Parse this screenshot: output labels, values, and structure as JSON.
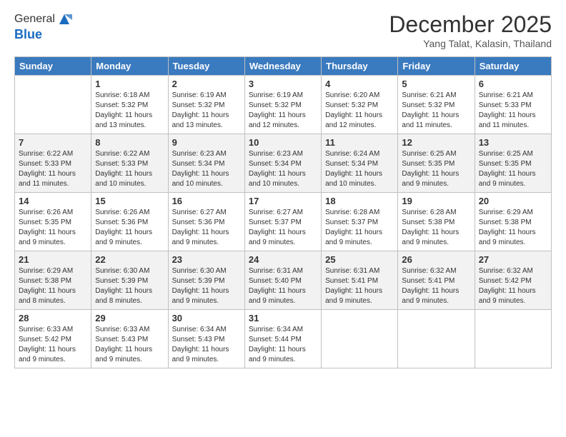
{
  "header": {
    "logo_line1": "General",
    "logo_line2": "Blue",
    "month": "December 2025",
    "location": "Yang Talat, Kalasin, Thailand"
  },
  "days_of_week": [
    "Sunday",
    "Monday",
    "Tuesday",
    "Wednesday",
    "Thursday",
    "Friday",
    "Saturday"
  ],
  "weeks": [
    [
      {
        "day": "",
        "info": ""
      },
      {
        "day": "1",
        "info": "Sunrise: 6:18 AM\nSunset: 5:32 PM\nDaylight: 11 hours\nand 13 minutes."
      },
      {
        "day": "2",
        "info": "Sunrise: 6:19 AM\nSunset: 5:32 PM\nDaylight: 11 hours\nand 13 minutes."
      },
      {
        "day": "3",
        "info": "Sunrise: 6:19 AM\nSunset: 5:32 PM\nDaylight: 11 hours\nand 12 minutes."
      },
      {
        "day": "4",
        "info": "Sunrise: 6:20 AM\nSunset: 5:32 PM\nDaylight: 11 hours\nand 12 minutes."
      },
      {
        "day": "5",
        "info": "Sunrise: 6:21 AM\nSunset: 5:32 PM\nDaylight: 11 hours\nand 11 minutes."
      },
      {
        "day": "6",
        "info": "Sunrise: 6:21 AM\nSunset: 5:33 PM\nDaylight: 11 hours\nand 11 minutes."
      }
    ],
    [
      {
        "day": "7",
        "info": "Sunrise: 6:22 AM\nSunset: 5:33 PM\nDaylight: 11 hours\nand 11 minutes."
      },
      {
        "day": "8",
        "info": "Sunrise: 6:22 AM\nSunset: 5:33 PM\nDaylight: 11 hours\nand 10 minutes."
      },
      {
        "day": "9",
        "info": "Sunrise: 6:23 AM\nSunset: 5:34 PM\nDaylight: 11 hours\nand 10 minutes."
      },
      {
        "day": "10",
        "info": "Sunrise: 6:23 AM\nSunset: 5:34 PM\nDaylight: 11 hours\nand 10 minutes."
      },
      {
        "day": "11",
        "info": "Sunrise: 6:24 AM\nSunset: 5:34 PM\nDaylight: 11 hours\nand 10 minutes."
      },
      {
        "day": "12",
        "info": "Sunrise: 6:25 AM\nSunset: 5:35 PM\nDaylight: 11 hours\nand 9 minutes."
      },
      {
        "day": "13",
        "info": "Sunrise: 6:25 AM\nSunset: 5:35 PM\nDaylight: 11 hours\nand 9 minutes."
      }
    ],
    [
      {
        "day": "14",
        "info": "Sunrise: 6:26 AM\nSunset: 5:35 PM\nDaylight: 11 hours\nand 9 minutes."
      },
      {
        "day": "15",
        "info": "Sunrise: 6:26 AM\nSunset: 5:36 PM\nDaylight: 11 hours\nand 9 minutes."
      },
      {
        "day": "16",
        "info": "Sunrise: 6:27 AM\nSunset: 5:36 PM\nDaylight: 11 hours\nand 9 minutes."
      },
      {
        "day": "17",
        "info": "Sunrise: 6:27 AM\nSunset: 5:37 PM\nDaylight: 11 hours\nand 9 minutes."
      },
      {
        "day": "18",
        "info": "Sunrise: 6:28 AM\nSunset: 5:37 PM\nDaylight: 11 hours\nand 9 minutes."
      },
      {
        "day": "19",
        "info": "Sunrise: 6:28 AM\nSunset: 5:38 PM\nDaylight: 11 hours\nand 9 minutes."
      },
      {
        "day": "20",
        "info": "Sunrise: 6:29 AM\nSunset: 5:38 PM\nDaylight: 11 hours\nand 9 minutes."
      }
    ],
    [
      {
        "day": "21",
        "info": "Sunrise: 6:29 AM\nSunset: 5:38 PM\nDaylight: 11 hours\nand 8 minutes."
      },
      {
        "day": "22",
        "info": "Sunrise: 6:30 AM\nSunset: 5:39 PM\nDaylight: 11 hours\nand 8 minutes."
      },
      {
        "day": "23",
        "info": "Sunrise: 6:30 AM\nSunset: 5:39 PM\nDaylight: 11 hours\nand 9 minutes."
      },
      {
        "day": "24",
        "info": "Sunrise: 6:31 AM\nSunset: 5:40 PM\nDaylight: 11 hours\nand 9 minutes."
      },
      {
        "day": "25",
        "info": "Sunrise: 6:31 AM\nSunset: 5:41 PM\nDaylight: 11 hours\nand 9 minutes."
      },
      {
        "day": "26",
        "info": "Sunrise: 6:32 AM\nSunset: 5:41 PM\nDaylight: 11 hours\nand 9 minutes."
      },
      {
        "day": "27",
        "info": "Sunrise: 6:32 AM\nSunset: 5:42 PM\nDaylight: 11 hours\nand 9 minutes."
      }
    ],
    [
      {
        "day": "28",
        "info": "Sunrise: 6:33 AM\nSunset: 5:42 PM\nDaylight: 11 hours\nand 9 minutes."
      },
      {
        "day": "29",
        "info": "Sunrise: 6:33 AM\nSunset: 5:43 PM\nDaylight: 11 hours\nand 9 minutes."
      },
      {
        "day": "30",
        "info": "Sunrise: 6:34 AM\nSunset: 5:43 PM\nDaylight: 11 hours\nand 9 minutes."
      },
      {
        "day": "31",
        "info": "Sunrise: 6:34 AM\nSunset: 5:44 PM\nDaylight: 11 hours\nand 9 minutes."
      },
      {
        "day": "",
        "info": ""
      },
      {
        "day": "",
        "info": ""
      },
      {
        "day": "",
        "info": ""
      }
    ]
  ]
}
